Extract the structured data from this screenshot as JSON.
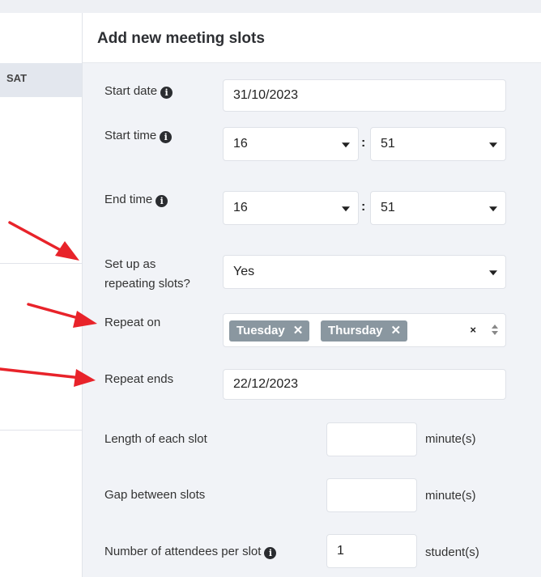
{
  "calendar": {
    "day_header": "SAT"
  },
  "form": {
    "title": "Add new meeting slots",
    "start_date": {
      "label": "Start date",
      "value": "31/10/2023"
    },
    "start_time": {
      "label": "Start time",
      "hour": "16",
      "minute": "51",
      "separator": ":"
    },
    "end_time": {
      "label": "End time",
      "hour": "16",
      "minute": "51",
      "separator": ":"
    },
    "repeating": {
      "label_line1": "Set up as",
      "label_line2": "repeating slots?",
      "value": "Yes"
    },
    "repeat_on": {
      "label": "Repeat on",
      "tags": [
        "Tuesday",
        "Thursday"
      ],
      "remove_glyph": "✕",
      "clear_glyph": "×"
    },
    "repeat_ends": {
      "label": "Repeat ends",
      "value": "22/12/2023"
    },
    "slot_length": {
      "label": "Length of each slot",
      "value": "",
      "unit": "minute(s)"
    },
    "slot_gap": {
      "label": "Gap between slots",
      "value": "",
      "unit": "minute(s)"
    },
    "attendees": {
      "label": "Number of attendees per slot",
      "value": "1",
      "unit": "student(s)"
    },
    "info_glyph": "i"
  },
  "annotations": {
    "arrow_color": "#e8232a",
    "arrow_count": 3
  }
}
